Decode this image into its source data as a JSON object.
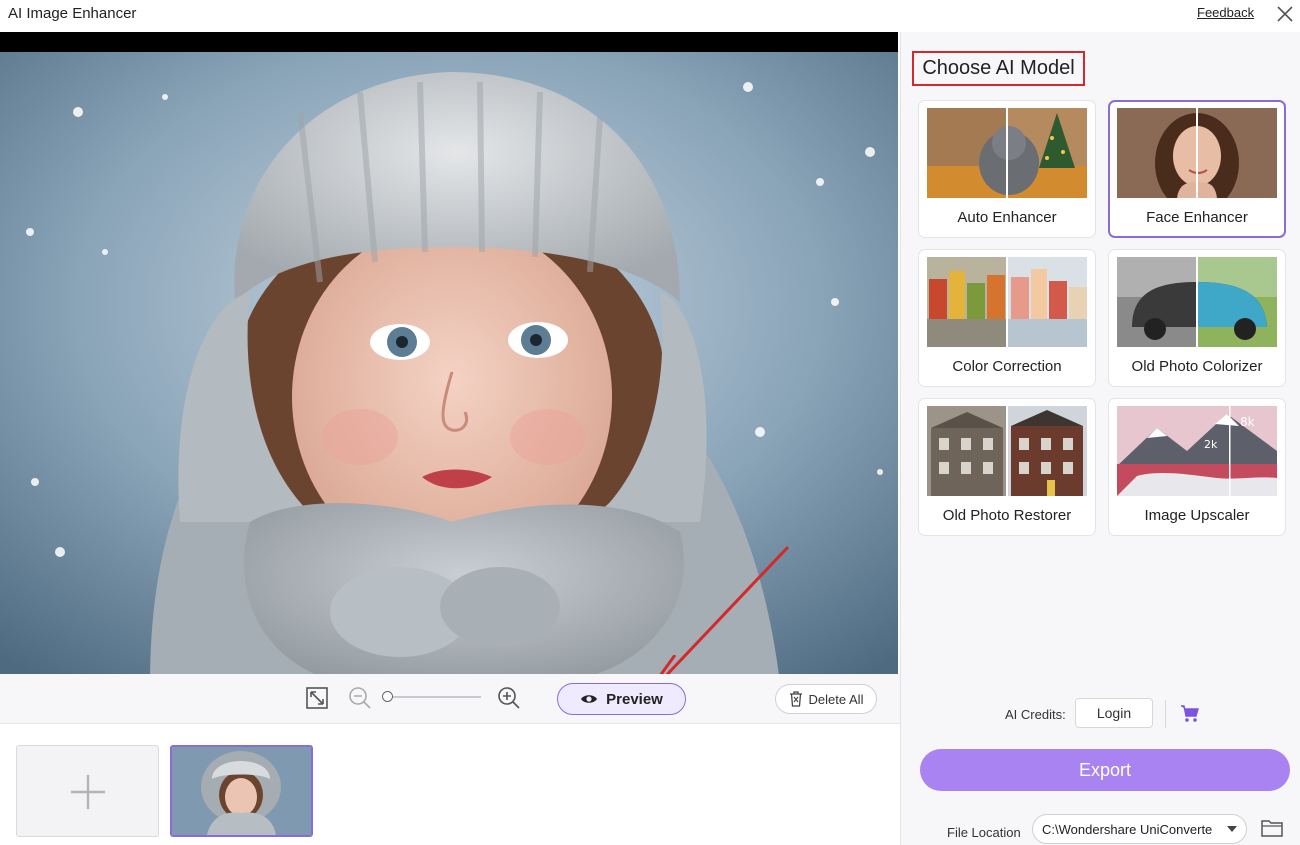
{
  "window": {
    "title": "AI Image Enhancer",
    "feedback_label": "Feedback",
    "close_icon": "close-icon"
  },
  "toolbar": {
    "fit_icon": "fit-screen-icon",
    "zoom_out_icon": "zoom-out-icon",
    "zoom_in_icon": "zoom-in-icon",
    "zoom_level": 0,
    "preview_label": "Preview",
    "preview_icon": "eye-icon",
    "delete_all_label": "Delete All",
    "delete_icon": "trash-icon"
  },
  "thumbnails": {
    "add_icon": "plus-icon",
    "items": [
      {
        "selected": true
      }
    ]
  },
  "models_panel": {
    "title": "Choose AI Model",
    "models": [
      {
        "label": "Auto Enhancer",
        "selected": false
      },
      {
        "label": "Face Enhancer",
        "selected": true
      },
      {
        "label": "Color Correction",
        "selected": false
      },
      {
        "label": "Old Photo Colorizer",
        "selected": false
      },
      {
        "label": "Old Photo Restorer",
        "selected": false
      },
      {
        "label": "Image Upscaler",
        "selected": false
      }
    ],
    "upscaler_badges": [
      "8k",
      "2k"
    ]
  },
  "account": {
    "credits_label": "AI Credits:",
    "login_label": "Login",
    "cart_icon": "cart-icon"
  },
  "export": {
    "label": "Export",
    "file_location_label": "File Location",
    "file_location_value": "C:\\Wondershare UniConverte",
    "folder_icon": "folder-icon"
  },
  "colors": {
    "accent": "#8a6cd8",
    "export_button": "#a983f2",
    "highlight_border": "#d22a2a"
  }
}
